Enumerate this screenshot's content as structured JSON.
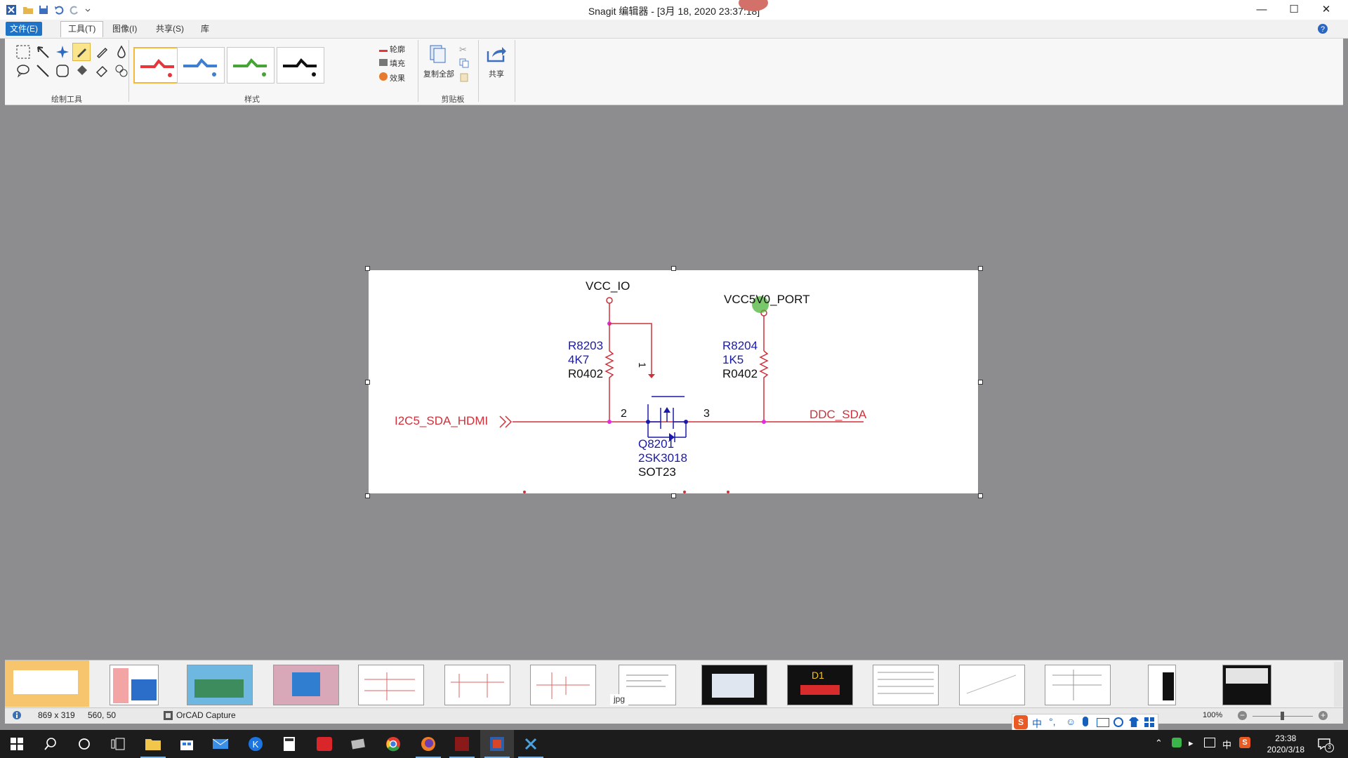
{
  "window": {
    "title": "Snagit 编辑器 - [3月 18, 2020 23:37:18]"
  },
  "menu": {
    "file": "文件(E)",
    "tools": "工具(T)",
    "image": "图像(I)",
    "share": "共享(S)",
    "library": "库"
  },
  "ribbon": {
    "group_draw_tools": "绘制工具",
    "group_styles": "样式",
    "group_clipboard": "剪贴板",
    "outline": "轮廓",
    "fill": "填充",
    "effects": "效果",
    "copy_all": "复制全部",
    "share": "共享",
    "style_colors": [
      "#e8353a",
      "#3f7fd2",
      "#46a335",
      "#111111"
    ]
  },
  "schematic": {
    "vcc_io": "VCC_IO",
    "vcc5v0": "VCC5V0_PORT",
    "r8203": "R8203",
    "r8203_val": "4K7",
    "r8203_pkg": "R0402",
    "r8204": "R8204",
    "r8204_val": "1K5",
    "r8204_pkg": "R0402",
    "net_left": "I2C5_SDA_HDMI",
    "net_right": "DDC_SDA",
    "pin1": "1",
    "pin2": "2",
    "pin3": "3",
    "q_ref": "Q8201",
    "q_part": "2SK3018",
    "q_pkg": "SOT23"
  },
  "thumbnails": {
    "jpg_label": "jpg",
    "d1_label": "D1"
  },
  "status": {
    "size": "869 x 319",
    "cursor": "560,  50",
    "app": "OrCAD Capture",
    "zoom": "100%"
  },
  "ime": {
    "mode": "中"
  },
  "taskbar": {
    "time": "23:38",
    "date": "2020/3/18",
    "lang": "中",
    "notifications": "3"
  }
}
